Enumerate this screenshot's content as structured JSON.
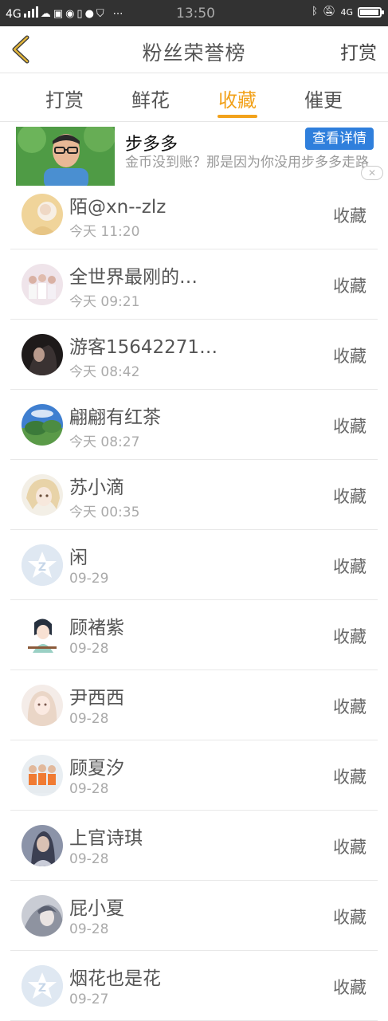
{
  "status_bar": {
    "network": "4G",
    "time": "13:50",
    "right_network": "4G",
    "battery_level_percent": 95
  },
  "header": {
    "title": "粉丝荣誉榜",
    "right_action": "打赏"
  },
  "tabs": [
    {
      "label": "打赏",
      "active": false
    },
    {
      "label": "鲜花",
      "active": false
    },
    {
      "label": "收藏",
      "active": true
    },
    {
      "label": "催更",
      "active": false
    }
  ],
  "ad": {
    "title": "步多多",
    "button": "查看详情",
    "description": "金币没到账？那是因为你没用步多多走路"
  },
  "list": [
    {
      "name": "陌@xn--zlz",
      "time": "今天 11:20",
      "action": "收藏",
      "avatar": "photo"
    },
    {
      "name": "全世界最刚的…",
      "time": "今天 09:21",
      "action": "收藏",
      "avatar": "photo"
    },
    {
      "name": "游客15642271…",
      "time": "今天 08:42",
      "action": "收藏",
      "avatar": "photo"
    },
    {
      "name": "翩翩有红茶",
      "time": "今天 08:27",
      "action": "收藏",
      "avatar": "photo"
    },
    {
      "name": "苏小滴",
      "time": "今天 00:35",
      "action": "收藏",
      "avatar": "photo"
    },
    {
      "name": "闲",
      "time": "09-29",
      "action": "收藏",
      "avatar": "default"
    },
    {
      "name": "顾褚紫",
      "time": "09-28",
      "action": "收藏",
      "avatar": "photo"
    },
    {
      "name": "尹西西",
      "time": "09-28",
      "action": "收藏",
      "avatar": "photo"
    },
    {
      "name": "顾夏汐",
      "time": "09-28",
      "action": "收藏",
      "avatar": "photo"
    },
    {
      "name": "上官诗琪",
      "time": "09-28",
      "action": "收藏",
      "avatar": "photo"
    },
    {
      "name": "屁小夏",
      "time": "09-28",
      "action": "收藏",
      "avatar": "photo"
    },
    {
      "name": "烟花也是花",
      "time": "09-27",
      "action": "收藏",
      "avatar": "default"
    }
  ],
  "colors": {
    "accent": "#f2a21b",
    "ad_button": "#2f7fdc",
    "status_bar": "#323232"
  }
}
